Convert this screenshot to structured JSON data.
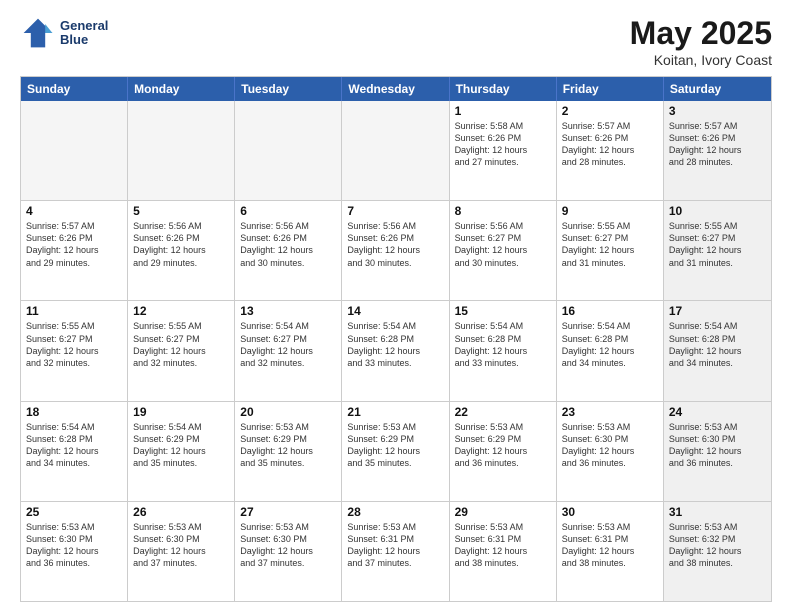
{
  "header": {
    "logo_line1": "General",
    "logo_line2": "Blue",
    "month": "May 2025",
    "location": "Koitan, Ivory Coast"
  },
  "days_of_week": [
    "Sunday",
    "Monday",
    "Tuesday",
    "Wednesday",
    "Thursday",
    "Friday",
    "Saturday"
  ],
  "weeks": [
    [
      {
        "day": "",
        "info": "",
        "empty": true
      },
      {
        "day": "",
        "info": "",
        "empty": true
      },
      {
        "day": "",
        "info": "",
        "empty": true
      },
      {
        "day": "",
        "info": "",
        "empty": true
      },
      {
        "day": "1",
        "info": "Sunrise: 5:58 AM\nSunset: 6:26 PM\nDaylight: 12 hours\nand 27 minutes."
      },
      {
        "day": "2",
        "info": "Sunrise: 5:57 AM\nSunset: 6:26 PM\nDaylight: 12 hours\nand 28 minutes."
      },
      {
        "day": "3",
        "info": "Sunrise: 5:57 AM\nSunset: 6:26 PM\nDaylight: 12 hours\nand 28 minutes.",
        "shaded": true
      }
    ],
    [
      {
        "day": "4",
        "info": "Sunrise: 5:57 AM\nSunset: 6:26 PM\nDaylight: 12 hours\nand 29 minutes."
      },
      {
        "day": "5",
        "info": "Sunrise: 5:56 AM\nSunset: 6:26 PM\nDaylight: 12 hours\nand 29 minutes."
      },
      {
        "day": "6",
        "info": "Sunrise: 5:56 AM\nSunset: 6:26 PM\nDaylight: 12 hours\nand 30 minutes."
      },
      {
        "day": "7",
        "info": "Sunrise: 5:56 AM\nSunset: 6:26 PM\nDaylight: 12 hours\nand 30 minutes."
      },
      {
        "day": "8",
        "info": "Sunrise: 5:56 AM\nSunset: 6:27 PM\nDaylight: 12 hours\nand 30 minutes."
      },
      {
        "day": "9",
        "info": "Sunrise: 5:55 AM\nSunset: 6:27 PM\nDaylight: 12 hours\nand 31 minutes."
      },
      {
        "day": "10",
        "info": "Sunrise: 5:55 AM\nSunset: 6:27 PM\nDaylight: 12 hours\nand 31 minutes.",
        "shaded": true
      }
    ],
    [
      {
        "day": "11",
        "info": "Sunrise: 5:55 AM\nSunset: 6:27 PM\nDaylight: 12 hours\nand 32 minutes."
      },
      {
        "day": "12",
        "info": "Sunrise: 5:55 AM\nSunset: 6:27 PM\nDaylight: 12 hours\nand 32 minutes."
      },
      {
        "day": "13",
        "info": "Sunrise: 5:54 AM\nSunset: 6:27 PM\nDaylight: 12 hours\nand 32 minutes."
      },
      {
        "day": "14",
        "info": "Sunrise: 5:54 AM\nSunset: 6:28 PM\nDaylight: 12 hours\nand 33 minutes."
      },
      {
        "day": "15",
        "info": "Sunrise: 5:54 AM\nSunset: 6:28 PM\nDaylight: 12 hours\nand 33 minutes."
      },
      {
        "day": "16",
        "info": "Sunrise: 5:54 AM\nSunset: 6:28 PM\nDaylight: 12 hours\nand 34 minutes."
      },
      {
        "day": "17",
        "info": "Sunrise: 5:54 AM\nSunset: 6:28 PM\nDaylight: 12 hours\nand 34 minutes.",
        "shaded": true
      }
    ],
    [
      {
        "day": "18",
        "info": "Sunrise: 5:54 AM\nSunset: 6:28 PM\nDaylight: 12 hours\nand 34 minutes."
      },
      {
        "day": "19",
        "info": "Sunrise: 5:54 AM\nSunset: 6:29 PM\nDaylight: 12 hours\nand 35 minutes."
      },
      {
        "day": "20",
        "info": "Sunrise: 5:53 AM\nSunset: 6:29 PM\nDaylight: 12 hours\nand 35 minutes."
      },
      {
        "day": "21",
        "info": "Sunrise: 5:53 AM\nSunset: 6:29 PM\nDaylight: 12 hours\nand 35 minutes."
      },
      {
        "day": "22",
        "info": "Sunrise: 5:53 AM\nSunset: 6:29 PM\nDaylight: 12 hours\nand 36 minutes."
      },
      {
        "day": "23",
        "info": "Sunrise: 5:53 AM\nSunset: 6:30 PM\nDaylight: 12 hours\nand 36 minutes."
      },
      {
        "day": "24",
        "info": "Sunrise: 5:53 AM\nSunset: 6:30 PM\nDaylight: 12 hours\nand 36 minutes.",
        "shaded": true
      }
    ],
    [
      {
        "day": "25",
        "info": "Sunrise: 5:53 AM\nSunset: 6:30 PM\nDaylight: 12 hours\nand 36 minutes."
      },
      {
        "day": "26",
        "info": "Sunrise: 5:53 AM\nSunset: 6:30 PM\nDaylight: 12 hours\nand 37 minutes."
      },
      {
        "day": "27",
        "info": "Sunrise: 5:53 AM\nSunset: 6:30 PM\nDaylight: 12 hours\nand 37 minutes."
      },
      {
        "day": "28",
        "info": "Sunrise: 5:53 AM\nSunset: 6:31 PM\nDaylight: 12 hours\nand 37 minutes."
      },
      {
        "day": "29",
        "info": "Sunrise: 5:53 AM\nSunset: 6:31 PM\nDaylight: 12 hours\nand 38 minutes."
      },
      {
        "day": "30",
        "info": "Sunrise: 5:53 AM\nSunset: 6:31 PM\nDaylight: 12 hours\nand 38 minutes."
      },
      {
        "day": "31",
        "info": "Sunrise: 5:53 AM\nSunset: 6:32 PM\nDaylight: 12 hours\nand 38 minutes.",
        "shaded": true
      }
    ]
  ]
}
